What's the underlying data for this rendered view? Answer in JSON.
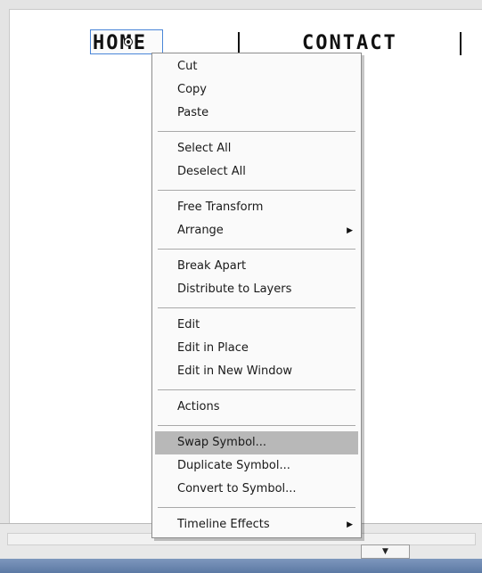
{
  "stage": {
    "nav": {
      "home_label": "HOME",
      "contact_label": "CONTACT"
    }
  },
  "context_menu": {
    "groups": [
      [
        {
          "label": "Cut"
        },
        {
          "label": "Copy"
        },
        {
          "label": "Paste"
        }
      ],
      [
        {
          "label": "Select All"
        },
        {
          "label": "Deselect All"
        }
      ],
      [
        {
          "label": "Free Transform"
        },
        {
          "label": "Arrange",
          "submenu": true
        }
      ],
      [
        {
          "label": "Break Apart"
        },
        {
          "label": "Distribute to Layers"
        }
      ],
      [
        {
          "label": "Edit"
        },
        {
          "label": "Edit in Place"
        },
        {
          "label": "Edit in New Window"
        }
      ],
      [
        {
          "label": "Actions"
        }
      ],
      [
        {
          "label": "Swap Symbol...",
          "highlighted": true
        },
        {
          "label": "Duplicate Symbol..."
        },
        {
          "label": "Convert to Symbol..."
        }
      ],
      [
        {
          "label": "Timeline Effects",
          "submenu": true
        }
      ]
    ],
    "submenu_icon": "submenu-arrow-icon",
    "highlight_color": "#b8b8b8"
  },
  "scroll": {
    "down_icon": "chevron-down-icon"
  }
}
